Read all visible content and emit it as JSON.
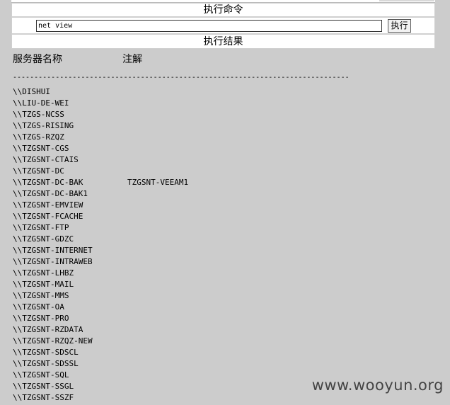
{
  "panel": {
    "command_title": "执行命令",
    "command_value": "net view",
    "exec_button": "执行",
    "result_title": "执行结果"
  },
  "results": {
    "headers": [
      "服务器名称",
      "注解"
    ],
    "separator": "-------------------------------------------------------------------------------",
    "servers": [
      {
        "name": "\\\\DISHUI",
        "remark": ""
      },
      {
        "name": "\\\\LIU-DE-WEI",
        "remark": ""
      },
      {
        "name": "\\\\TZGS-NCSS",
        "remark": ""
      },
      {
        "name": "\\\\TZGS-RISING",
        "remark": ""
      },
      {
        "name": "\\\\TZGS-RZQZ",
        "remark": ""
      },
      {
        "name": "\\\\TZGSNT-CGS",
        "remark": ""
      },
      {
        "name": "\\\\TZGSNT-CTAIS",
        "remark": ""
      },
      {
        "name": "\\\\TZGSNT-DC",
        "remark": ""
      },
      {
        "name": "\\\\TZGSNT-DC-BAK",
        "remark": "TZGSNT-VEEAM1"
      },
      {
        "name": "\\\\TZGSNT-DC-BAK1",
        "remark": ""
      },
      {
        "name": "\\\\TZGSNT-EMVIEW",
        "remark": ""
      },
      {
        "name": "\\\\TZGSNT-FCACHE",
        "remark": ""
      },
      {
        "name": "\\\\TZGSNT-FTP",
        "remark": ""
      },
      {
        "name": "\\\\TZGSNT-GDZC",
        "remark": ""
      },
      {
        "name": "\\\\TZGSNT-INTERNET",
        "remark": ""
      },
      {
        "name": "\\\\TZGSNT-INTRAWEB",
        "remark": ""
      },
      {
        "name": "\\\\TZGSNT-LHBZ",
        "remark": ""
      },
      {
        "name": "\\\\TZGSNT-MAIL",
        "remark": ""
      },
      {
        "name": "\\\\TZGSNT-MMS",
        "remark": ""
      },
      {
        "name": "\\\\TZGSNT-OA",
        "remark": ""
      },
      {
        "name": "\\\\TZGSNT-PRO",
        "remark": ""
      },
      {
        "name": "\\\\TZGSNT-RZDATA",
        "remark": ""
      },
      {
        "name": "\\\\TZGSNT-RZQZ-NEW",
        "remark": ""
      },
      {
        "name": "\\\\TZGSNT-SDSCL",
        "remark": ""
      },
      {
        "name": "\\\\TZGSNT-SDSSL",
        "remark": ""
      },
      {
        "name": "\\\\TZGSNT-SQL",
        "remark": ""
      },
      {
        "name": "\\\\TZGSNT-SSGL",
        "remark": ""
      },
      {
        "name": "\\\\TZGSNT-SSZF",
        "remark": ""
      }
    ]
  },
  "watermark": "www.wooyun.org"
}
